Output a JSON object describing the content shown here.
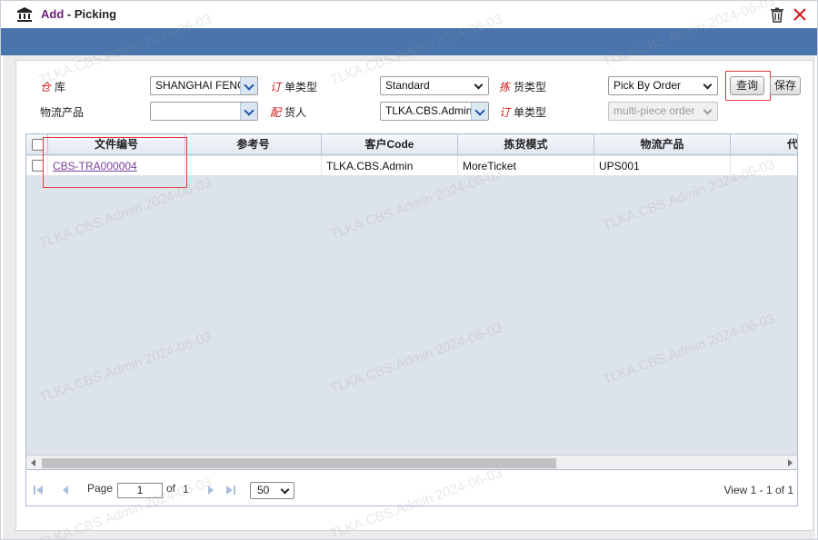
{
  "dialog": {
    "title_prefix": "Add",
    "title_sep": " - ",
    "title_main": "Picking",
    "icons": {
      "app": "bank-icon",
      "delete": "trash-icon",
      "close": "close-icon"
    }
  },
  "form": {
    "warehouse": {
      "label_req": "仓",
      "label_rest": "库",
      "value": "SHANGHAI FENG"
    },
    "order_type": {
      "label_req": "订",
      "label_rest": "单类型",
      "value": "Standard"
    },
    "pick_type": {
      "label_req": "拣",
      "label_rest": "货类型",
      "value": "Pick By Order"
    },
    "logistics_product": {
      "label": "物流产品",
      "value": ""
    },
    "consignor": {
      "label_req": "配",
      "label_rest": "货人",
      "value": "TLKA.CBS.Admin"
    },
    "order_type_2": {
      "label_req": "订",
      "label_rest": "单类型",
      "value": "multi-piece order"
    },
    "query_label": "查询",
    "save_label": "保存"
  },
  "grid": {
    "columns": [
      "文件编号",
      "参考号",
      "客户Code",
      "拣货模式",
      "物流产品",
      "代"
    ],
    "rows": [
      {
        "doc_no": "CBS-TRA000004",
        "ref_no": "",
        "customer_code": "TLKA.CBS.Admin",
        "pick_mode": "MoreTicket",
        "product": "UPS001",
        "extra": ""
      }
    ]
  },
  "pager": {
    "page_label": "Page",
    "page_value": "1",
    "of_label": "of",
    "total_pages": "1",
    "page_size": "50",
    "view_text": "View 1 - 1 of 1"
  },
  "watermark": {
    "text": "TLKA.CBS.Admin 2024-06-03"
  },
  "colors": {
    "band": "#4a74ac",
    "accent": "#6b1f7a",
    "required": "#d11a1a",
    "highlight": "#e23a3a",
    "link": "#7a3d9a"
  }
}
